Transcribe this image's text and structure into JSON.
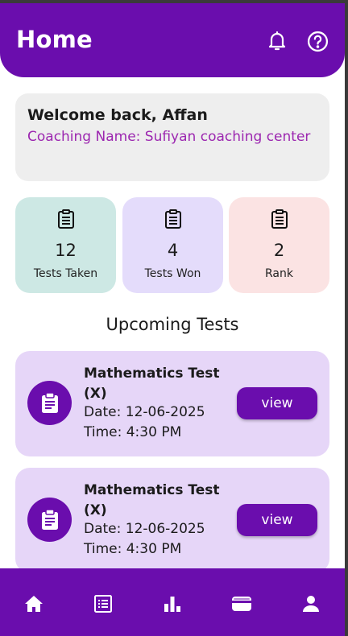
{
  "header": {
    "title": "Home",
    "icons": [
      "bell-icon",
      "help-icon"
    ]
  },
  "welcome": {
    "title": "Welcome back, Affan",
    "coaching": "Coaching Name: Sufiyan coaching center"
  },
  "stats": [
    {
      "value": "12",
      "label": "Tests Taken",
      "icon": "clipboard-icon",
      "bg": "#cde8e4"
    },
    {
      "value": "4",
      "label": "Tests Won",
      "icon": "clipboard-icon",
      "bg": "#e4dcfb"
    },
    {
      "value": "2",
      "label": "Rank",
      "icon": "clipboard-icon",
      "bg": "#fbe3e3"
    }
  ],
  "upcoming": {
    "title": "Upcoming Tests",
    "tests": [
      {
        "name": "Mathematics Test (X)",
        "date": "Date: 12-06-2025",
        "time": "Time: 4:30 PM",
        "action": "view"
      },
      {
        "name": "Mathematics Test (X)",
        "date": "Date: 12-06-2025",
        "time": "Time: 4:30 PM",
        "action": "view"
      }
    ]
  },
  "bottom_nav": [
    "home-icon",
    "tests-list-icon",
    "leaderboard-icon",
    "wallet-icon",
    "profile-icon"
  ],
  "colors": {
    "primary": "#6a0dad",
    "accent_text": "#9c27b0",
    "card_bg": "#e6d6f8"
  }
}
